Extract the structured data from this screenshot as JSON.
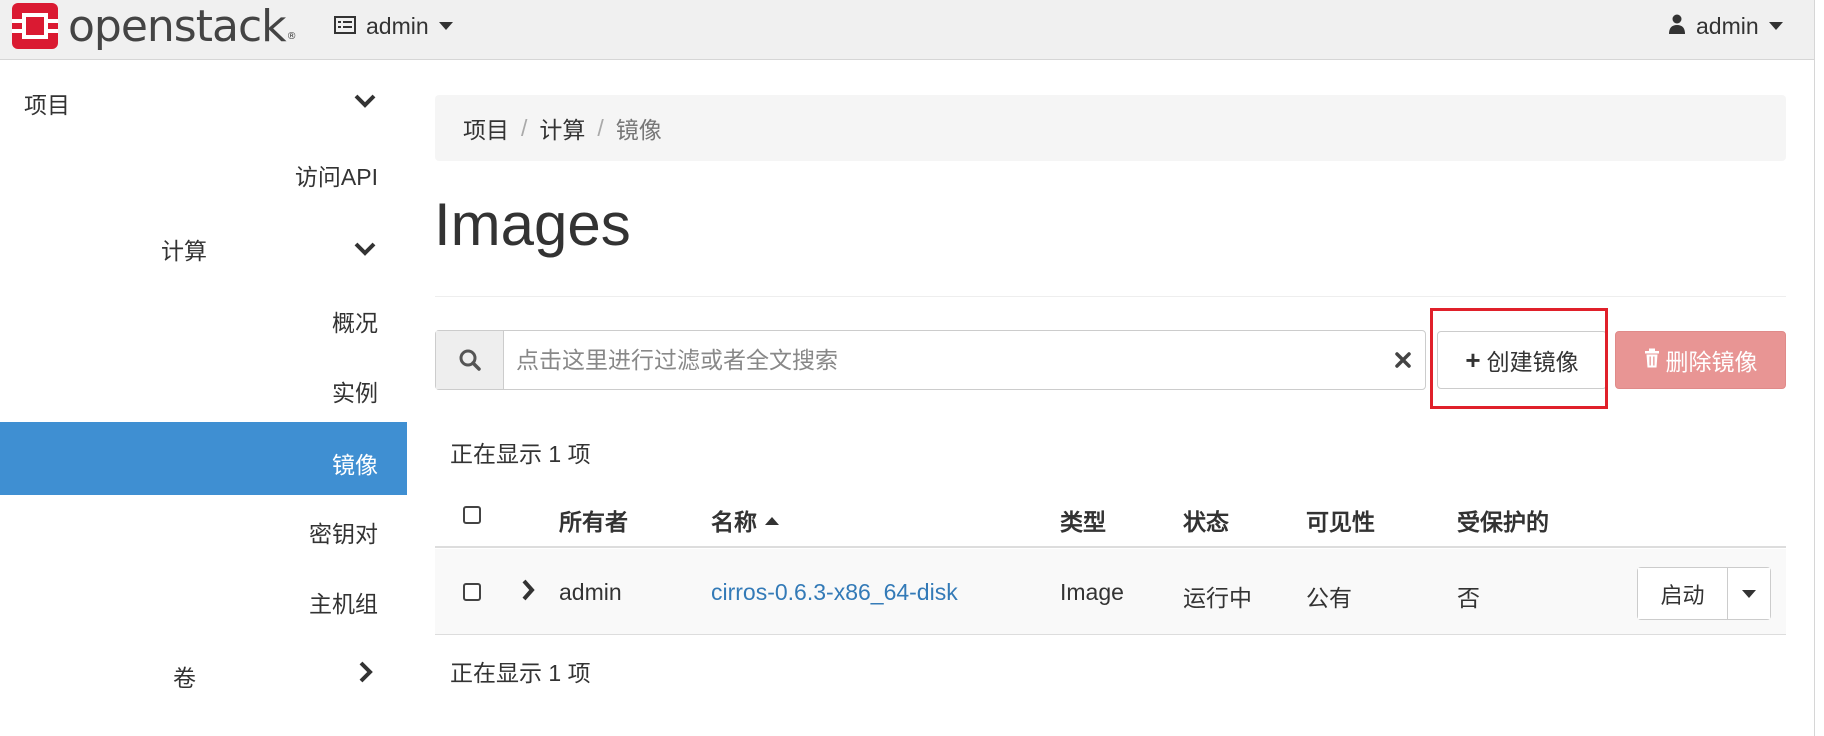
{
  "brand": {
    "name": "openstack",
    "trademark": "®",
    "color": "#da1a32"
  },
  "topbar": {
    "project_label": "admin",
    "project_icon": "server-icon",
    "user_label": "admin",
    "user_icon": "user-icon"
  },
  "sidebar": {
    "items": [
      {
        "label": "项目",
        "chevron": "down"
      },
      {
        "label": "访问API"
      },
      {
        "label": "计算",
        "chevron": "down"
      },
      {
        "label": "概况"
      },
      {
        "label": "实例"
      },
      {
        "label": "镜像",
        "active": true
      },
      {
        "label": "密钥对"
      },
      {
        "label": "主机组"
      },
      {
        "label": "卷",
        "chevron": "right"
      }
    ],
    "active_color": "#3f8fd2"
  },
  "breadcrumb": {
    "items": [
      "项目",
      "计算",
      "镜像"
    ],
    "separator": "/"
  },
  "page": {
    "title": "Images"
  },
  "toolbar": {
    "search_placeholder": "点击这里进行过滤或者全文搜索",
    "create_label": "创建镜像",
    "delete_label": "删除镜像",
    "highlight_color": "#e0202a"
  },
  "table": {
    "count_text_top": "正在显示 1 项",
    "count_text_bottom": "正在显示 1 项",
    "columns": [
      "所有者",
      "名称",
      "类型",
      "状态",
      "可见性",
      "受保护的"
    ],
    "sorted_column": "名称",
    "rows": [
      {
        "owner": "admin",
        "name": "cirros-0.6.3-x86_64-disk",
        "type": "Image",
        "status": "运行中",
        "visibility": "公有",
        "protected": "否",
        "action": "启动"
      }
    ]
  }
}
